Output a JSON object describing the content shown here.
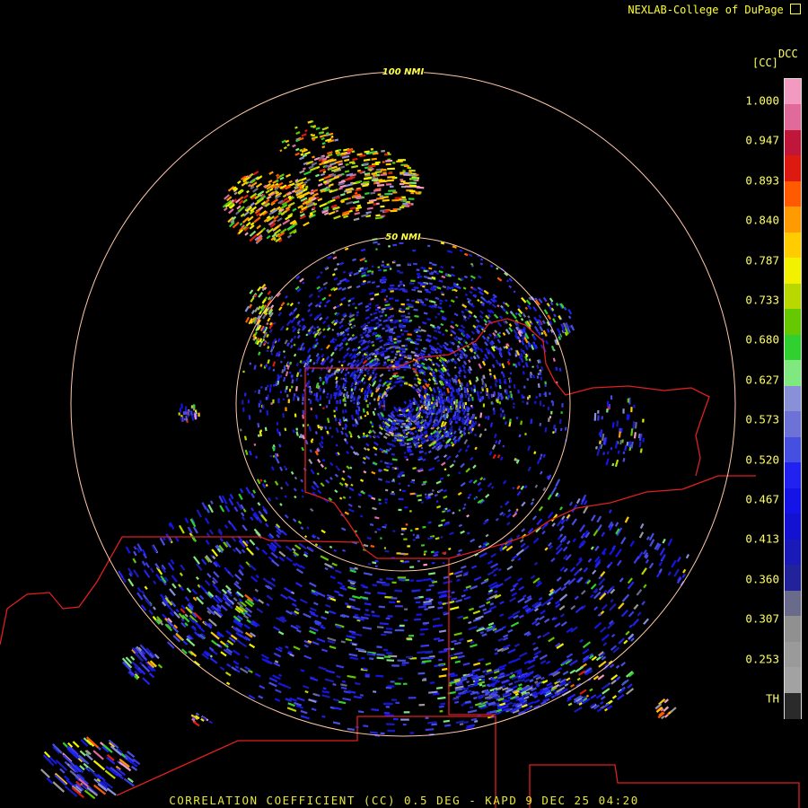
{
  "header": {
    "credit": "NEXLAB-College of DuPage"
  },
  "footer": {
    "caption": "CORRELATION COEFFICIENT (CC) 0.5 DEG - KAPD 9 DEC 25 04:20"
  },
  "colorbar": {
    "product": "DCC",
    "unit": "[CC]",
    "labels": [
      "1.000",
      "0.947",
      "0.893",
      "0.840",
      "0.787",
      "0.733",
      "0.680",
      "0.627",
      "0.573",
      "0.520",
      "0.467",
      "0.413",
      "0.360",
      "0.307",
      "0.253",
      "TH"
    ],
    "segments": [
      "#f29ac0",
      "#e06a9a",
      "#c0163a",
      "#dd1a10",
      "#ff5a00",
      "#ff9a00",
      "#ffcc00",
      "#f2f200",
      "#b8d800",
      "#66c800",
      "#2fd02f",
      "#7fe87f",
      "#8890d8",
      "#6d73d6",
      "#4650e0",
      "#2222f0",
      "#1414e6",
      "#1212d0",
      "#1a1ab8",
      "#22229a",
      "#6a6a8a",
      "#909090",
      "#9a9a9a",
      "#a2a2a2",
      "#2a2a2a"
    ]
  },
  "map": {
    "ring_labels": [
      "100 NMI",
      "50 NMI"
    ],
    "ring_color": "#ffc8a8",
    "border_color": "#dd2020"
  }
}
